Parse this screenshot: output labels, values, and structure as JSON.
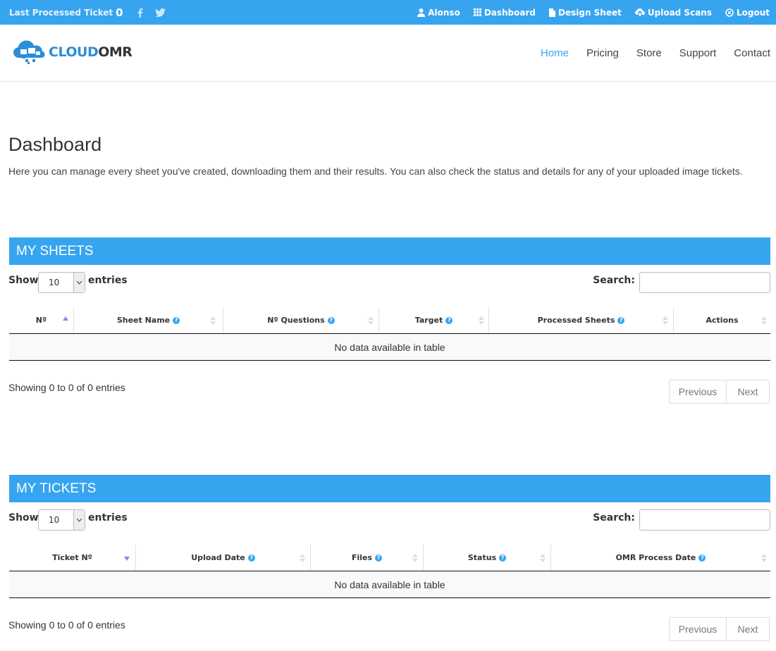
{
  "topbar": {
    "last_processed_label": "Last Processed Ticket",
    "last_processed_count": "0",
    "links": [
      "Alonso",
      "Dashboard",
      "Design Sheet",
      "Upload Scans",
      "Logout"
    ]
  },
  "brand": {
    "part1": "CLOUD",
    "part2": "OMR"
  },
  "nav": [
    "Home",
    "Pricing",
    "Store",
    "Support",
    "Contact"
  ],
  "page": {
    "title": "Dashboard",
    "intro": "Here you can manage every sheet you've created, downloading them and their results. You can also check the status and details for any of your uploaded image tickets."
  },
  "sheets": {
    "title": "MY SHEETS",
    "show_label": "Show",
    "page_size": "10",
    "entries_label": "entries",
    "search_label": "Search:",
    "columns": [
      "Nº",
      "Sheet Name",
      "Nº Questions",
      "Target",
      "Processed Sheets",
      "Actions"
    ],
    "empty_text": "No data available in table",
    "info": "Showing 0 to 0 of 0 entries",
    "prev": "Previous",
    "next": "Next"
  },
  "tickets": {
    "title": "MY TICKETS",
    "show_label": "Show",
    "page_size": "10",
    "entries_label": "entries",
    "search_label": "Search:",
    "columns": [
      "Ticket Nº",
      "Upload Date",
      "Files",
      "Status",
      "OMR Process Date"
    ],
    "empty_text": "No data available in table",
    "info": "Showing 0 to 0 of 0 entries",
    "prev": "Previous",
    "next": "Next"
  },
  "colors": {
    "accent": "#37a4f0",
    "brand_blue": "#2b8ed8"
  }
}
